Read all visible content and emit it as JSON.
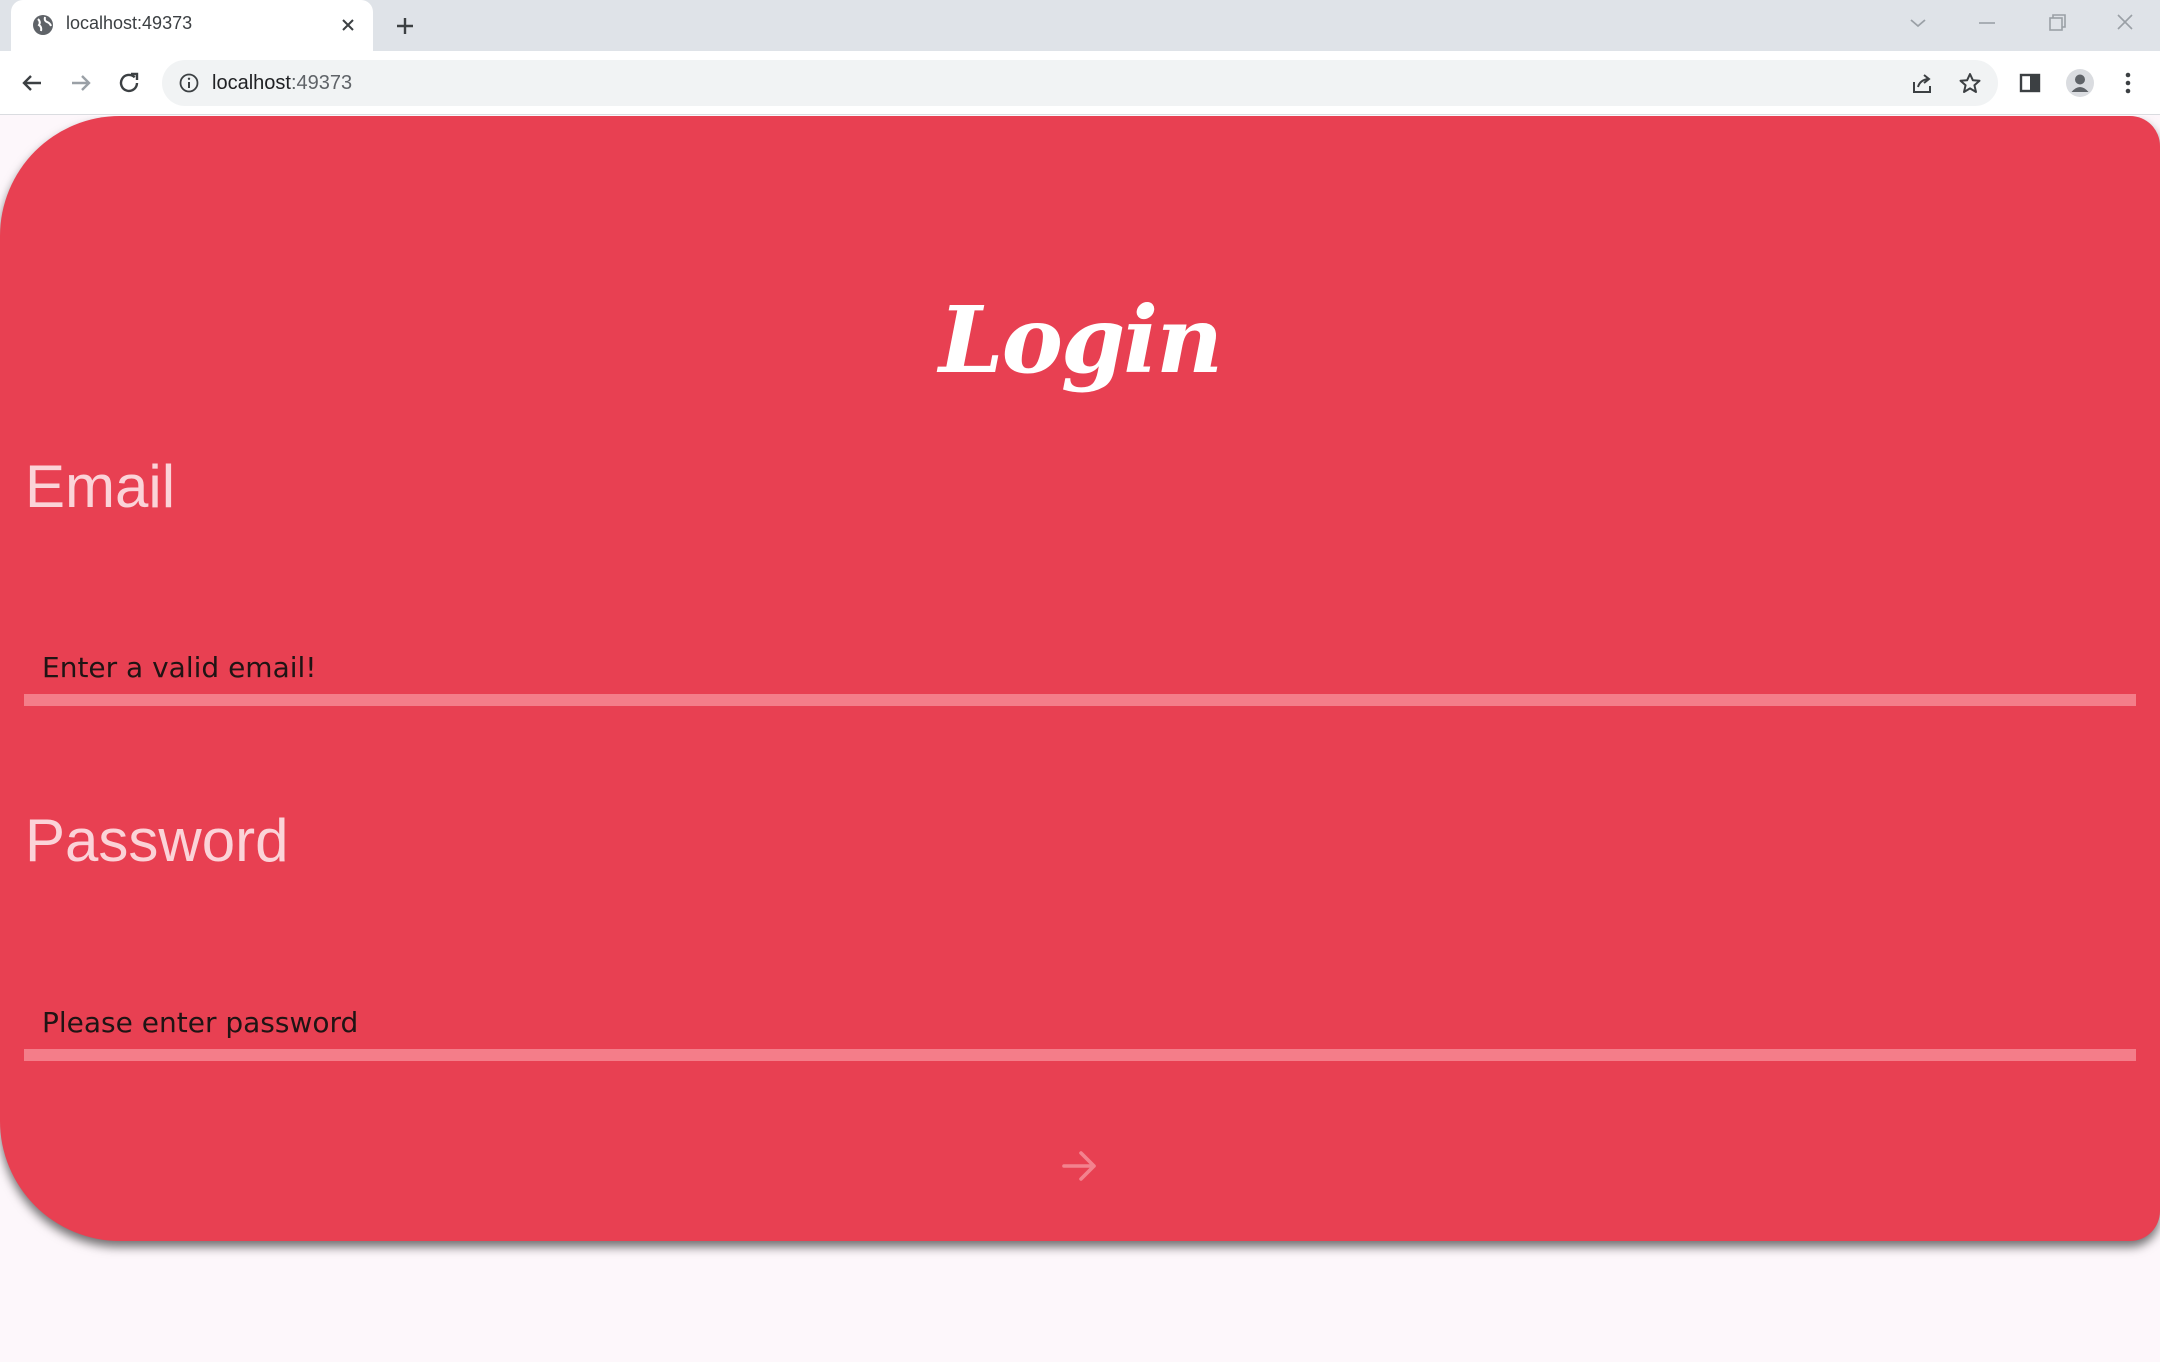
{
  "browser": {
    "tab_title": "localhost:49373",
    "url_host": "localhost",
    "url_port": ":49373"
  },
  "page": {
    "title": "Login",
    "email": {
      "label": "Email",
      "placeholder": "Enter a valid email!",
      "value": ""
    },
    "password": {
      "label": "Password",
      "placeholder": "Please enter password",
      "value": ""
    },
    "submit_icon": "arrow-right-icon"
  },
  "colors": {
    "card_background": "#e84052",
    "input_underline": "#f47d89",
    "label_text": "#fbd3d8",
    "page_background": "#fdf7fb"
  }
}
